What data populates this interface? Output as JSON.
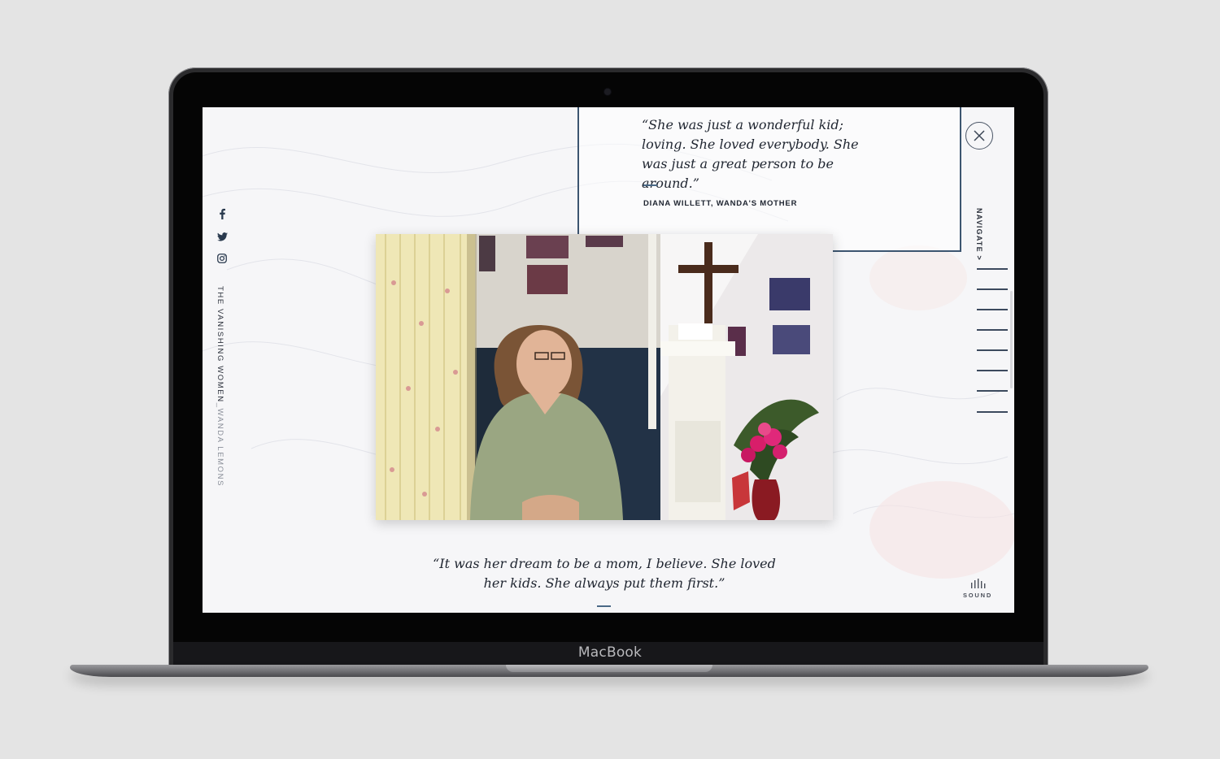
{
  "device": {
    "brand": "MacBook"
  },
  "site": {
    "title": "THE VANISHING WOMEN",
    "subtitle": "_WANDA LEMONS"
  },
  "social": [
    "facebook-icon",
    "twitter-icon",
    "instagram-icon"
  ],
  "top_quote": {
    "text": "“She was just a wonderful kid; loving. She loved everybody. She was just a great person to be around.”",
    "attribution": "DIANA WILLETT, WANDA'S MOTHER"
  },
  "nav": {
    "label": "NAVIGATE >",
    "items_count": 8
  },
  "bottom_quote": {
    "text": "“It was her dream to be a mom, I believe. She loved her kids. She always put them first.”"
  },
  "sound": {
    "label": "SOUND"
  },
  "colors": {
    "accent": "#3c5570",
    "text": "#1f2530",
    "background": "#f6f6f8"
  }
}
